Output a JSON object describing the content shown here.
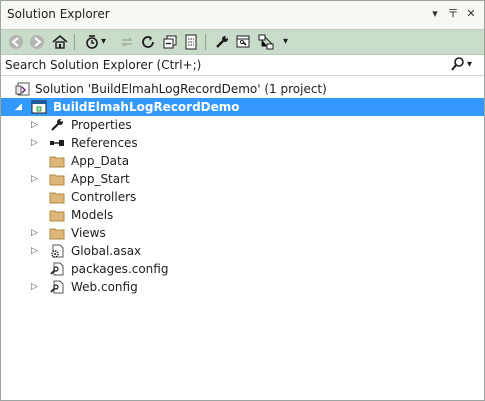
{
  "window": {
    "title": "Solution Explorer",
    "pin_glyph": "〒",
    "dropdown_glyph": "▾",
    "close_glyph": "✕"
  },
  "toolbar": {
    "buttons": [
      "back",
      "forward",
      "home",
      "pending-changes-filter",
      "sync",
      "refresh",
      "collapse-all",
      "show-all-files",
      "properties",
      "preview",
      "view-class-diagram"
    ],
    "dropdown_glyph": "▾"
  },
  "search": {
    "placeholder": "Search Solution Explorer (Ctrl+;)",
    "value": ""
  },
  "tree": {
    "solution_label": "Solution 'BuildElmahLogRecordDemo' (1 project)",
    "project_label": "BuildElmahLogRecordDemo",
    "items": [
      {
        "label": "Properties",
        "icon": "wrench-icon",
        "expander": true
      },
      {
        "label": "References",
        "icon": "references-icon",
        "expander": true
      },
      {
        "label": "App_Data",
        "icon": "folder-icon",
        "expander": false
      },
      {
        "label": "App_Start",
        "icon": "folder-icon",
        "expander": true
      },
      {
        "label": "Controllers",
        "icon": "folder-icon",
        "expander": false
      },
      {
        "label": "Models",
        "icon": "folder-icon",
        "expander": false
      },
      {
        "label": "Views",
        "icon": "folder-icon",
        "expander": true
      },
      {
        "label": "Global.asax",
        "icon": "gear-file-icon",
        "expander": true
      },
      {
        "label": "packages.config",
        "icon": "config-file-icon",
        "expander": false
      },
      {
        "label": "Web.config",
        "icon": "config-file-icon",
        "expander": true
      }
    ]
  },
  "colors": {
    "selection": "#3399ff",
    "toolbar": "#c9dcc9",
    "folder": "#dcb67a"
  }
}
